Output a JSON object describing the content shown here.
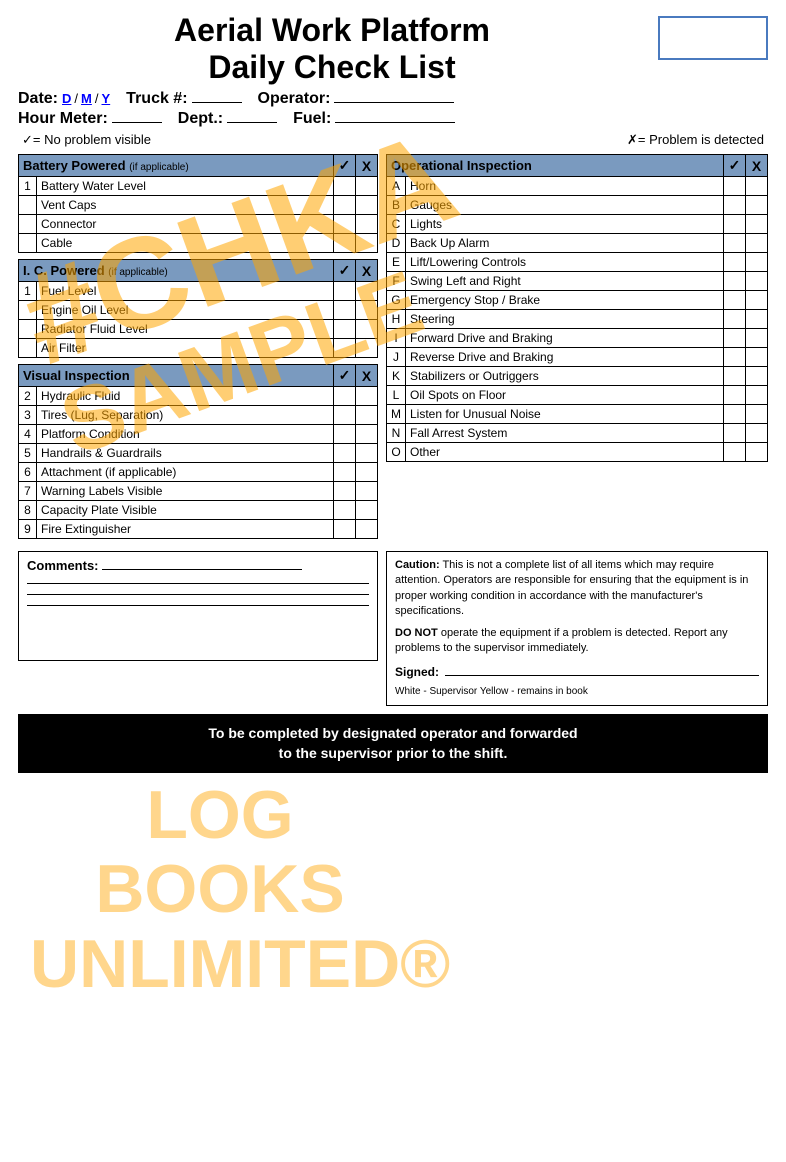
{
  "header": {
    "title_line1": "Aerial Work Platform",
    "title_line2": "Daily Check List",
    "date_label": "Date:",
    "date_d": "D",
    "date_m": "M",
    "date_y": "Y",
    "truck_label": "Truck #:",
    "operator_label": "Operator:",
    "hour_meter_label": "Hour Meter:",
    "dept_label": "Dept.:",
    "fuel_label": "Fuel:",
    "legend_check": "✓= No problem visible",
    "legend_x": "✗= Problem is detected"
  },
  "battery_section": {
    "title": "Battery Powered",
    "subtitle": "(if applicable)",
    "check_header": "✓",
    "x_header": "X",
    "items": [
      {
        "num": "1",
        "label": "Battery Water Level"
      },
      {
        "num": "",
        "label": "Vent Caps"
      },
      {
        "num": "",
        "label": "Connector"
      },
      {
        "num": "",
        "label": "Cable"
      }
    ]
  },
  "ic_section": {
    "title": "I. C. Powered",
    "subtitle": "(if applicable)",
    "check_header": "✓",
    "x_header": "X",
    "items": [
      {
        "num": "1",
        "label": "Fuel Level"
      },
      {
        "num": "",
        "label": "Engine Oil Level"
      },
      {
        "num": "",
        "label": "Radiator Fluid Level"
      },
      {
        "num": "",
        "label": "Air Filter"
      }
    ]
  },
  "visual_section": {
    "title": "Visual Inspection",
    "check_header": "✓",
    "x_header": "X",
    "items": [
      {
        "num": "2",
        "label": "Hydraulic Fluid"
      },
      {
        "num": "3",
        "label": "Tires (Lug, Separation)"
      },
      {
        "num": "4",
        "label": "Platform Condition"
      },
      {
        "num": "5",
        "label": "Handrails & Guardrails"
      },
      {
        "num": "6",
        "label": "Attachment (if applicable)"
      },
      {
        "num": "7",
        "label": "Warning Labels Visible"
      },
      {
        "num": "8",
        "label": "Capacity Plate Visible"
      },
      {
        "num": "9",
        "label": "Fire Extinguisher"
      }
    ]
  },
  "operational_section": {
    "title": "Operational Inspection",
    "check_header": "✓",
    "x_header": "X",
    "items": [
      {
        "letter": "A",
        "label": "Horn"
      },
      {
        "letter": "B",
        "label": "Gauges"
      },
      {
        "letter": "C",
        "label": "Lights"
      },
      {
        "letter": "D",
        "label": "Back Up Alarm"
      },
      {
        "letter": "E",
        "label": "Lift/Lowering Controls"
      },
      {
        "letter": "F",
        "label": "Swing Left and Right"
      },
      {
        "letter": "G",
        "label": "Emergency Stop / Brake"
      },
      {
        "letter": "H",
        "label": "Steering"
      },
      {
        "letter": "I",
        "label": "Forward Drive and Braking"
      },
      {
        "letter": "J",
        "label": "Reverse Drive and Braking"
      },
      {
        "letter": "K",
        "label": "Stabilizers or Outriggers"
      },
      {
        "letter": "L",
        "label": "Oil Spots on Floor"
      },
      {
        "letter": "M",
        "label": "Listen for Unusual Noise"
      },
      {
        "letter": "N",
        "label": "Fall Arrest System"
      },
      {
        "letter": "O",
        "label": "Other"
      }
    ]
  },
  "comments": {
    "label": "Comments:"
  },
  "caution": {
    "bold_text": "Caution:",
    "text1": " This is not a complete list of all items which may require attention. Operators are responsible for ensuring that the equipment is in proper working condition in accordance with the manufacturer's specifications.",
    "do_not_bold": "DO NOT",
    "text2": " operate the equipment if a problem is detected. Report any problems to the supervisor immediately.",
    "signed_label": "Signed:",
    "copy_info": "White - Supervisor     Yellow - remains in book"
  },
  "footer": {
    "line1": "To be completed by designated operator and forwarded",
    "line2": "to the supervisor prior to the shift."
  },
  "watermark": "#CHKA",
  "watermark2_line1": "LOG BOOKS",
  "watermark2_line2": "UNLIMITED®"
}
